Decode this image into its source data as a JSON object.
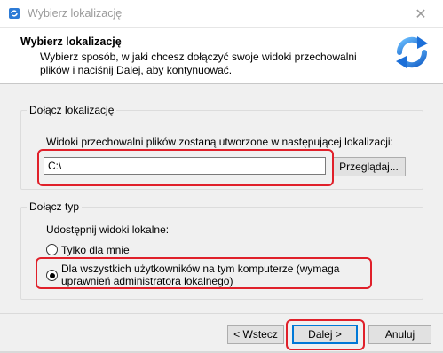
{
  "window": {
    "title": "Wybierz lokalizację"
  },
  "header": {
    "title": "Wybierz lokalizację",
    "description": "Wybierz sposób, w jaki chcesz dołączyć swoje widoki przechowalni plików i naciśnij Dalej, aby kontynuować."
  },
  "location_group": {
    "legend": "Dołącz lokalizację",
    "instruction": "Widoki przechowalni plików zostaną utworzone w następującej lokalizacji:",
    "path_value": "C:\\",
    "browse_label": "Przeglądaj..."
  },
  "type_group": {
    "legend": "Dołącz typ",
    "share_label": "Udostępnij widoki lokalne:",
    "options": [
      {
        "label": "Tylko dla mnie",
        "checked": false
      },
      {
        "label": "Dla wszystkich użytkowników na tym komputerze (wymaga uprawnień administratora lokalnego)",
        "checked": true
      }
    ]
  },
  "footer": {
    "back_label": "< Wstecz",
    "next_label": "Dalej >",
    "cancel_label": "Anuluj"
  },
  "colors": {
    "highlight": "#e0202a",
    "accent": "#0078d7"
  }
}
